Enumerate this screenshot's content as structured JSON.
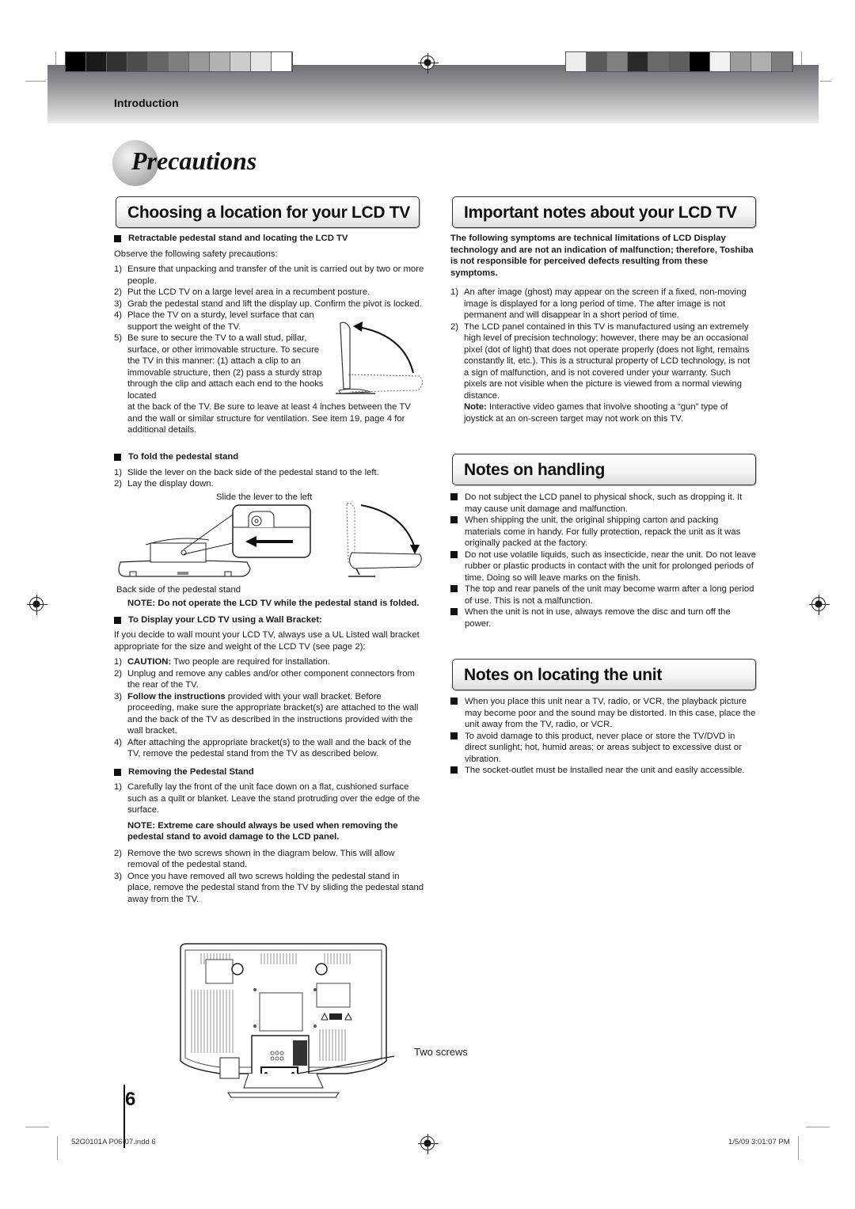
{
  "header": {
    "section_label": "Introduction",
    "swatches_left": [
      "#000000",
      "#1a1a1a",
      "#333333",
      "#4d4d4d",
      "#666666",
      "#7f7f7f",
      "#999999",
      "#b2b2b2",
      "#cccccc",
      "#e5e5e5",
      "#ffffff"
    ],
    "swatches_right": [
      "#eeeeee",
      "#5a5a5a",
      "#808080",
      "#2a2a2a",
      "#6a6a6a",
      "#5e5e5e",
      "#000000",
      "#f2f2f2",
      "#9c9c9c",
      "#b0b0b0",
      "#7e7e7e"
    ]
  },
  "page_title": "Precautions",
  "left": {
    "heading": "Choosing a location for your LCD TV",
    "s1": {
      "title": "Retractable pedestal stand and locating the LCD TV",
      "intro": "Observe the following safety precautions:",
      "items": [
        {
          "n": "1)",
          "t": "Ensure that unpacking and transfer of the unit is carried out by two or more people."
        },
        {
          "n": "2)",
          "t": "Put the LCD TV on a large level area in a recumbent posture."
        },
        {
          "n": "3)",
          "t": "Grab the pedestal stand and lift the display up. Confirm the pivot is locked."
        },
        {
          "n": "4)",
          "t": "Place the TV on a sturdy, level surface that can support the weight of the TV."
        },
        {
          "n": "5)",
          "t": "Be sure to secure the TV to a wall stud, pillar, surface, or other immovable structure. To secure the TV in this manner: (1) attach a clip to an immovable structure, then (2) pass a sturdy strap through the clip and attach each end to the hooks located"
        },
        {
          "n": "",
          "t": "at the back of the TV. Be sure to leave at least 4 inches between the TV and the wall or similar structure for ventilation. See item 19, page 4 for additional details."
        }
      ]
    },
    "s2": {
      "title": "To fold the pedestal stand",
      "items": [
        {
          "n": "1)",
          "t": "Slide the lever on the back side of the pedestal stand to the left."
        },
        {
          "n": "2)",
          "t": "Lay the display down."
        }
      ],
      "fig_caption_top": "Slide the lever to the left",
      "fig_caption_bottom": "Back side of the pedestal stand",
      "note": "NOTE: Do not operate the LCD TV while the pedestal stand is folded."
    },
    "s3": {
      "title": "To Display your LCD TV using a Wall Bracket:",
      "intro": "If you decide to wall mount your LCD TV, always use a UL Listed wall bracket appropriate for the size and weight of the LCD TV (see page 2):",
      "items": [
        {
          "n": "1)",
          "b": "CAUTION:",
          "t": " Two people are required for installation."
        },
        {
          "n": "2)",
          "b": "",
          "t": "Unplug and remove any cables and/or other component connectors from the rear of the TV."
        },
        {
          "n": "3)",
          "b": "Follow the instructions",
          "t": " provided with your wall bracket. Before proceeding, make sure the appropriate bracket(s) are attached to the wall and the back of the TV as described in the instructions provided with the wall bracket."
        },
        {
          "n": "4)",
          "b": "",
          "t": "After attaching the appropriate bracket(s) to the wall and the back of the TV, remove the pedestal stand from the TV as described below."
        }
      ]
    },
    "s4": {
      "title": "Removing the Pedestal Stand",
      "item1": {
        "n": "1)",
        "t": "Carefully lay the front of the unit face down on a flat, cushioned surface such as a quilt or blanket. Leave the stand protruding over the edge of the surface."
      },
      "note": "NOTE: Extreme care should always be used when removing the pedestal stand to avoid damage to the LCD panel.",
      "items": [
        {
          "n": "2)",
          "t": "Remove the two screws shown in the diagram below. This will allow removal of the pedestal stand."
        },
        {
          "n": "3)",
          "t": "Once you have removed all two screws holding the pedestal stand in place, remove the pedestal stand from the TV by sliding the pedestal stand away from the TV."
        }
      ],
      "fig_label": "Two screws"
    }
  },
  "right": {
    "important": {
      "heading": "Important notes about your LCD TV",
      "intro": "The following symptoms are technical limitations of LCD Display technology and are not an indication of malfunction; therefore, Toshiba is not responsible for perceived defects resulting from these symptoms.",
      "items": [
        {
          "n": "1)",
          "t": "An after image (ghost) may appear on the screen if a fixed, non-moving image is displayed for a long period of time. The after image is not permanent and will disappear in a short period of time."
        },
        {
          "n": "2)",
          "t": "The LCD panel contained in this TV is manufactured using an extremely high level of precision technology; however, there may be an occasional pixel (dot of light) that does not operate properly (does not light, remains constantly lit, etc.). This is a structural property of LCD technology, is not a sign of malfunction, and is not covered under your warranty. Such pixels are not visible when the picture is viewed from a normal viewing distance."
        }
      ],
      "note_label": "Note:",
      "note_text": " Interactive video games that involve shooting a “gun” type of joystick at an on-screen target may not work on this TV."
    },
    "handling": {
      "heading": "Notes on handling",
      "items": [
        "Do not subject the LCD panel to physical shock, such as dropping it. It may cause unit damage and malfunction.",
        "When shipping the unit, the original shipping carton and packing materials come in handy. For fully protection, repack the unit as it was originally packed at the factory.",
        "Do not use volatile liquids, such as insecticide, near the unit. Do not leave rubber or plastic products in contact with the unit for prolonged periods of time. Doing so will leave marks on the finish.",
        "The top and rear panels of the unit may become warm after a long period of use. This is not a malfunction.",
        "When the unit is not in use, always remove the disc and turn off the power."
      ]
    },
    "locating": {
      "heading": "Notes on locating the unit",
      "items": [
        "When you place this unit near a TV, radio, or VCR, the playback picture may become poor and the sound may be distorted. In this case, place the unit away from the TV, radio, or VCR.",
        "To avoid damage to this product, never place or store the TV/DVD in direct sunlight; hot, humid areas; or areas subject to excessive dust or vibration.",
        "The socket-outlet must be installed near the unit and easily accessible."
      ]
    }
  },
  "page_number": "6",
  "footer": {
    "file": "52G0101A P06-07.indd   6",
    "timestamp": "1/5/09   3:01:07 PM"
  }
}
